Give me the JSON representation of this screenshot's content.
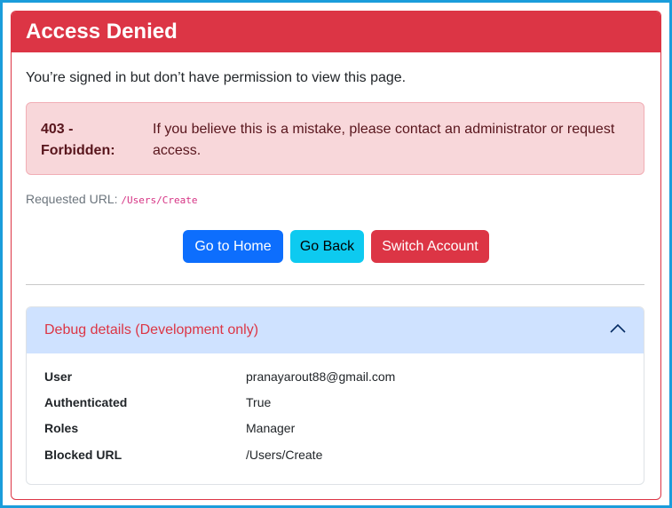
{
  "header": {
    "title": "Access Denied"
  },
  "intro": "You’re signed in but don’t have permission to view this page.",
  "alert": {
    "code": "403 - Forbidden:",
    "message": "If you believe this is a mistake, please contact an administrator or request access."
  },
  "requested": {
    "label": "Requested URL:",
    "url": "/Users/Create"
  },
  "buttons": {
    "home": "Go to Home",
    "back": "Go Back",
    "switch": "Switch Account"
  },
  "debug": {
    "title": "Debug details (Development only)",
    "expanded": true,
    "rows": [
      {
        "key": "User",
        "value": "pranayarout88@gmail.com"
      },
      {
        "key": "Authenticated",
        "value": "True"
      },
      {
        "key": "Roles",
        "value": "Manager"
      },
      {
        "key": "Blocked URL",
        "value": "/Users/Create"
      }
    ]
  },
  "colors": {
    "danger": "#dc3545",
    "primary": "#0d6efd",
    "info": "#0dcaf0",
    "alert_bg": "#f8d7da",
    "accordion_header_bg": "#cfe2ff",
    "frame_border": "#1a9ddb"
  },
  "icons": {
    "accordion_toggle": "chevron-up-icon"
  }
}
